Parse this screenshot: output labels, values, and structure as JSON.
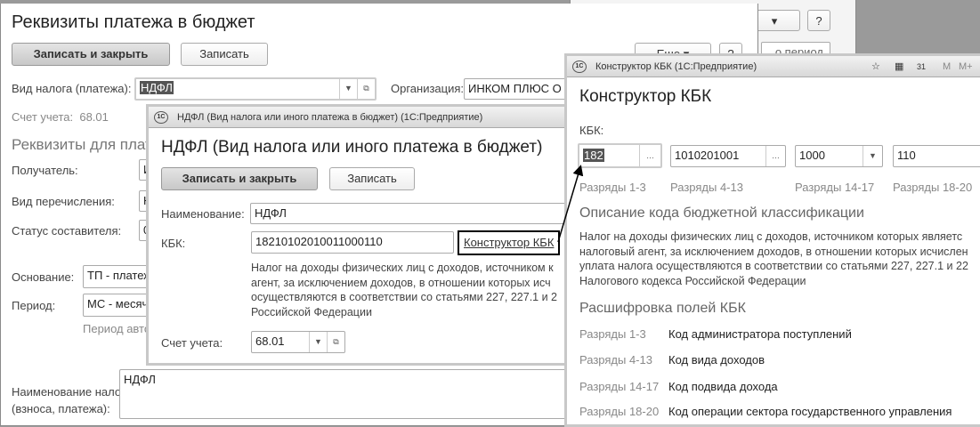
{
  "background_window": {
    "help_label": "?",
    "field_partial": "...о период"
  },
  "main": {
    "title": "Реквизиты платежа в бюджет",
    "save_close": "Записать и закрыть",
    "save": "Записать",
    "more": "Еще",
    "help": "?",
    "tax_type_label": "Вид налога (платежа):",
    "tax_type_value": "НДФЛ",
    "org_label": "Организация:",
    "org_value": "ИНКОМ ПЛЮС О",
    "account_label": "Счет учета:",
    "account_value": "68.01",
    "section_title": "Реквизиты для плат",
    "recipient_label": "Получатель:",
    "recipient_value": "И",
    "transfer_label": "Вид перечисления:",
    "transfer_value": "Н",
    "status_label": "Статус составителя:",
    "status_value": "0",
    "basis_label": "Основание:",
    "basis_value": "ТП - платеж",
    "period_label": "Период:",
    "period_value": "МС - месяч",
    "period_hint": "Период авто",
    "tax_name_label_1": "Наименование налога",
    "tax_name_label_2": "(взноса, платежа):",
    "tax_name_value": "НДФЛ"
  },
  "ndfl": {
    "window_title": "НДФЛ (Вид налога или иного платежа в бюджет)  (1С:Предприятие)",
    "logo": "1С",
    "heading": "НДФЛ (Вид налога или иного платежа в бюджет)",
    "save_close": "Записать и закрыть",
    "save": "Записать",
    "name_label": "Наименование:",
    "name_value": "НДФЛ",
    "kbk_label": "КБК:",
    "kbk_value": "18210102010011000110",
    "kbk_link": "Конструктор КБК",
    "description": [
      "Налог на доходы физических лиц с доходов, источником к",
      "агент, за исключением доходов, в отношении которых исч",
      "осуществляются в соответствии со статьями 227, 227.1 и 2",
      "Российской Федерации"
    ],
    "account_label": "Счет учета:",
    "account_value": "68.01"
  },
  "kbk": {
    "window_title": "Конструктор КБК  (1С:Предприятие)",
    "logo": "1С",
    "toolbar": {
      "m": "M",
      "mplus": "M+",
      "calendar": "31"
    },
    "heading": "Конструктор КБК",
    "kbk_label": "КБК:",
    "fields": [
      {
        "value": "182",
        "caption": "Разряды 1-3"
      },
      {
        "value": "1010201001",
        "caption": "Разряды 4-13"
      },
      {
        "value": "1000",
        "caption": "Разряды 14-17"
      },
      {
        "value": "110",
        "caption": "Разряды 18-20"
      }
    ],
    "desc_title": "Описание кода бюджетной классификации",
    "description": [
      "Налог на доходы физических лиц с доходов, источником которых являетс",
      "налоговый агент, за исключением доходов, в отношении которых исчислен",
      "уплата налога осуществляются в соответствии со статьями 227, 227.1 и 22",
      "Налогового кодекса Российской Федерации"
    ],
    "decode_title": "Расшифровка полей КБК",
    "decode": [
      {
        "range": "Разряды 1-3",
        "meaning": "Код администратора поступлений"
      },
      {
        "range": "Разряды 4-13",
        "meaning": "Код вида доходов"
      },
      {
        "range": "Разряды 14-17",
        "meaning": "Код подвида дохода"
      },
      {
        "range": "Разряды 18-20",
        "meaning": "Код операции сектора государственного управления"
      }
    ]
  }
}
